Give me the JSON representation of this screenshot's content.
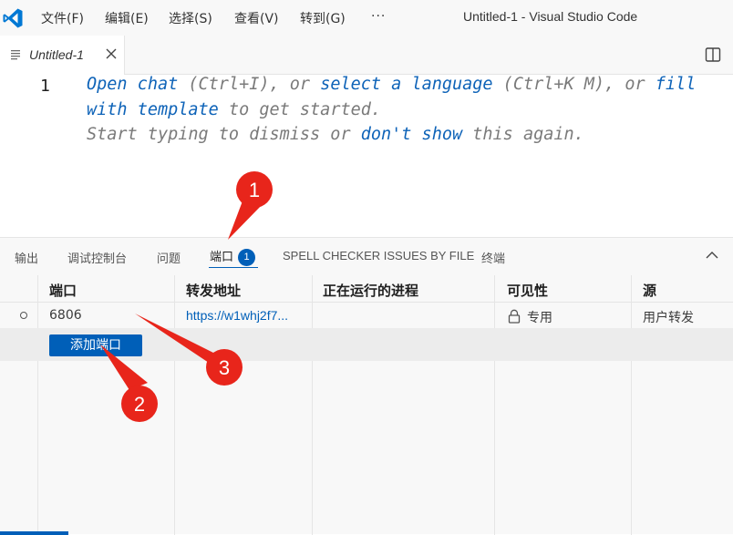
{
  "titlebar": {
    "menus": [
      "文件(F)",
      "编辑(E)",
      "选择(S)",
      "查看(V)",
      "转到(G)"
    ],
    "more": "···",
    "window_title": "Untitled-1 - Visual Studio Code"
  },
  "tabs": {
    "active_label": "Untitled-1"
  },
  "editor": {
    "line_number": "1",
    "hint_line1": [
      {
        "text": "Open chat",
        "link": true
      },
      {
        "text": " (Ctrl+I), or ",
        "link": false
      },
      {
        "text": "select a language",
        "link": true
      },
      {
        "text": " (Ctrl+K M), or ",
        "link": false
      },
      {
        "text": "fill",
        "link": true
      }
    ],
    "hint_line2": [
      {
        "text": "with template",
        "link": true
      },
      {
        "text": " to get started.",
        "link": false
      }
    ],
    "hint_line3": [
      {
        "text": "Start typing to dismiss or ",
        "link": false
      },
      {
        "text": "don't show",
        "link": true
      },
      {
        "text": " this again.",
        "link": false
      }
    ]
  },
  "panel": {
    "tabs": [
      {
        "label": "输出"
      },
      {
        "label": "调试控制台"
      },
      {
        "label": "问题"
      },
      {
        "label": "端口",
        "badge": "1"
      },
      {
        "label": "SPELL CHECKER ISSUES BY FILE"
      },
      {
        "label": "终端"
      }
    ],
    "ports_table": {
      "headers": [
        "端口",
        "转发地址",
        "正在运行的进程",
        "可见性",
        "源"
      ],
      "row": {
        "port": "6806",
        "address": "https://w1whj2f7...",
        "process": "",
        "visibility": "专用",
        "origin": "用户转发"
      },
      "add_button": "添加端口"
    }
  },
  "annotations": {
    "colors": {
      "marker": "#e8251b",
      "text": "#ffffff"
    },
    "markers": [
      "1",
      "2",
      "3"
    ]
  }
}
